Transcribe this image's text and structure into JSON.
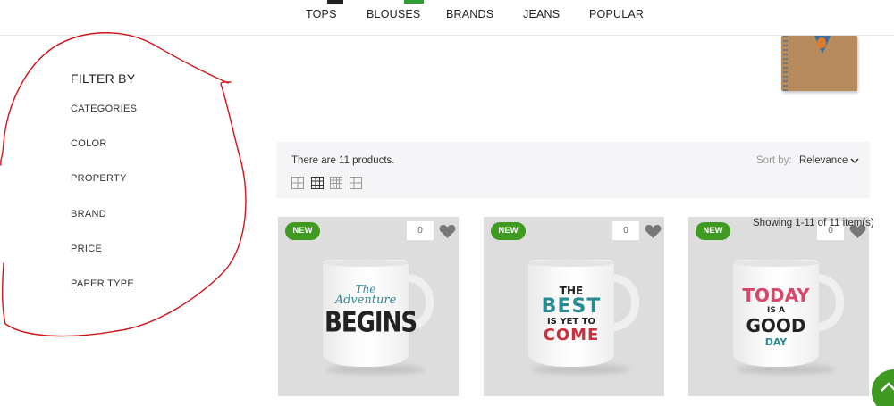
{
  "nav": {
    "items": [
      "TOPS",
      "BLOUSES",
      "BRANDS",
      "JEANS",
      "POPULAR"
    ]
  },
  "sidebar": {
    "title": "FILTER BY",
    "filters": [
      "CATEGORIES",
      "COLOR",
      "PROPERTY",
      "BRAND",
      "PRICE",
      "PAPER TYPE"
    ]
  },
  "toolbar": {
    "product_count": "There are 11 products.",
    "sort_label": "Sort by:",
    "sort_value": "Relevance",
    "grid_views": [
      "grid-2-icon",
      "grid-3-icon",
      "grid-4-icon",
      "list-icon"
    ]
  },
  "showing": "Showing 1-11 of 11 item(s)",
  "products": [
    {
      "badge": "NEW",
      "wishlist_count": "0",
      "print": [
        "The",
        "Adventure",
        "BEGINS"
      ]
    },
    {
      "badge": "NEW",
      "wishlist_count": "0",
      "print": [
        "THE",
        "BEST",
        "IS YET TO",
        "COME"
      ]
    },
    {
      "badge": "NEW",
      "wishlist_count": "0",
      "print": [
        "TODAY",
        "IS A",
        "GOOD",
        "DAY"
      ]
    }
  ],
  "colors": {
    "accent_green": "#3f9a21",
    "annotation_red": "#d0151b",
    "toolbar_bg": "#f5f5f8"
  }
}
